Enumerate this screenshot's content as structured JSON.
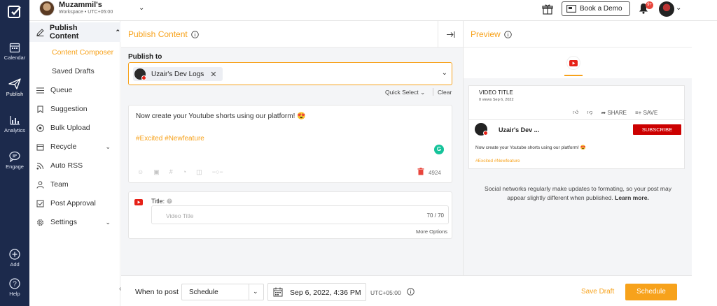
{
  "colors": {
    "accent": "#f7a21b",
    "rail": "#1c2a4c",
    "youtube": "#e62117",
    "subscribe": "#cc0000"
  },
  "workspace": {
    "name": "Muzammil's",
    "sub": "Workspace • UTC+05:00"
  },
  "header": {
    "book_demo": "Book a Demo",
    "notif_badge": "9+"
  },
  "rail": {
    "calendar": "Calendar",
    "publish": "Publish",
    "analytics": "Analytics",
    "engage": "Engage",
    "add": "Add",
    "help": "Help"
  },
  "subnav": {
    "head": "Publish Content",
    "children": [
      "Content Composer",
      "Saved Drafts"
    ],
    "items": [
      "Queue",
      "Suggestion",
      "Bulk Upload",
      "Recycle",
      "Auto RSS",
      "Team",
      "Post Approval",
      "Settings"
    ]
  },
  "composer": {
    "title": "Publish Content",
    "publish_to": "Publish to",
    "account_chip": "Uzair's Dev Logs",
    "quick_select": "Quick Select",
    "clear": "Clear",
    "post_text": "Now create your Youtube shorts using our platform! 😍",
    "hashtags": "#Excited #Newfeature",
    "char_count": "4924",
    "yt_title_label": "Title:",
    "yt_title_placeholder": "Video Title",
    "yt_title_count": "70 / 70",
    "more_options": "More Options"
  },
  "preview": {
    "title": "Preview",
    "video_title": "VIDEO TITLE",
    "video_meta": "0 views Sep 6, 2022",
    "share": "SHARE",
    "save": "SAVE",
    "channel": "Uzair's Dev ...",
    "subscribe": "SUBSCRIBE",
    "desc": "Now create your Youtube shorts using our platform! 😍",
    "tags": "#Excited #Newfeature",
    "note": "Social networks regularly make updates to formating, so your post may appear slightly different when published.",
    "learn_more": "Learn more."
  },
  "bottom": {
    "when_label": "When to post",
    "schedule_mode": "Schedule",
    "datetime": "Sep 6, 2022, 4:36 PM",
    "timezone": "UTC+05:00",
    "save_draft": "Save Draft",
    "schedule_button": "Schedule"
  }
}
